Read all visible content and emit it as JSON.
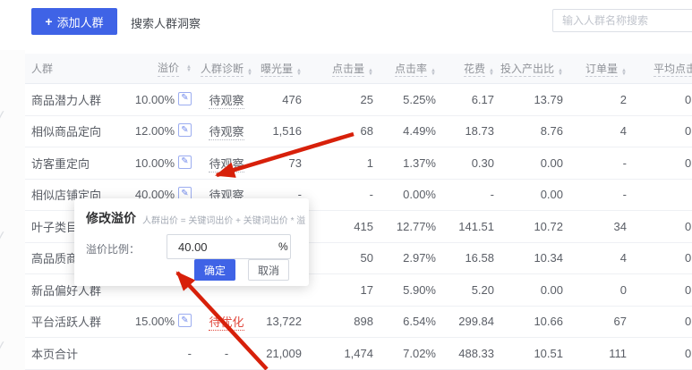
{
  "colors": {
    "accent_blue": "#3f63e6",
    "status_red": "#e0493e",
    "annotation_arrow_red": "#d7200a"
  },
  "icons": {
    "plus": "+",
    "pencil": "✎",
    "sort_up": "▲",
    "sort_down": "▼",
    "watermark_check": "✓"
  },
  "toolbar": {
    "add_button_label": "添加人群",
    "insight_link_label": "搜索人群洞察",
    "search_placeholder": "输入人群名称搜索"
  },
  "table": {
    "columns": [
      {
        "label": "人群",
        "sortable": false,
        "underline": false
      },
      {
        "label": "溢价",
        "sortable": true,
        "underline": true
      },
      {
        "label": "人群诊断",
        "sortable": true,
        "underline": true
      },
      {
        "label": "曝光量",
        "sortable": true,
        "underline": true
      },
      {
        "label": "点击量",
        "sortable": true,
        "underline": true
      },
      {
        "label": "点击率",
        "sortable": true,
        "underline": true
      },
      {
        "label": "花费",
        "sortable": true,
        "underline": true
      },
      {
        "label": "投入产出比",
        "sortable": true,
        "underline": true
      },
      {
        "label": "订单量",
        "sortable": true,
        "underline": true
      },
      {
        "label": "平均点击花费",
        "sortable": false,
        "underline": true
      }
    ],
    "rows": [
      {
        "name": "商品潜力人群",
        "premium": "10.00%",
        "has_edit": true,
        "diagnosis": "待观察",
        "status": "observe",
        "exposure": "476",
        "clicks": "25",
        "ctr": "5.25%",
        "cost": "6.17",
        "roi": "13.79",
        "orders": "2",
        "avg_cpc": "0"
      },
      {
        "name": "相似商品定向",
        "premium": "12.00%",
        "has_edit": true,
        "diagnosis": "待观察",
        "status": "observe",
        "exposure": "1,516",
        "clicks": "68",
        "ctr": "4.49%",
        "cost": "18.73",
        "roi": "8.76",
        "orders": "4",
        "avg_cpc": "0"
      },
      {
        "name": "访客重定向",
        "premium": "10.00%",
        "has_edit": true,
        "diagnosis": "待观察",
        "status": "observe",
        "exposure": "73",
        "clicks": "1",
        "ctr": "1.37%",
        "cost": "0.30",
        "roi": "0.00",
        "orders": "-",
        "avg_cpc": "0"
      },
      {
        "name": "相似店铺定向",
        "premium": "40.00%",
        "has_edit": true,
        "diagnosis": "待观察",
        "status": "observe",
        "exposure": "-",
        "clicks": "-",
        "ctr": "0.00%",
        "cost": "-",
        "roi": "0.00",
        "orders": "-",
        "avg_cpc": ""
      },
      {
        "name": "叶子类目定向",
        "premium": "",
        "has_edit": false,
        "diagnosis": "",
        "status": "",
        "exposure": "",
        "clicks": "415",
        "ctr": "12.77%",
        "cost": "141.51",
        "roi": "10.72",
        "orders": "34",
        "avg_cpc": "0"
      },
      {
        "name": "高品质商品人群",
        "premium": "",
        "has_edit": false,
        "diagnosis": "",
        "status": "",
        "exposure": "",
        "clicks": "50",
        "ctr": "2.97%",
        "cost": "16.58",
        "roi": "10.34",
        "orders": "4",
        "avg_cpc": "0"
      },
      {
        "name": "新品偏好人群",
        "premium": "",
        "has_edit": false,
        "diagnosis": "",
        "status": "",
        "exposure": "",
        "clicks": "17",
        "ctr": "5.90%",
        "cost": "5.20",
        "roi": "0.00",
        "orders": "0",
        "avg_cpc": "0"
      },
      {
        "name": "平台活跃人群",
        "premium": "15.00%",
        "has_edit": true,
        "diagnosis": "待优化",
        "status": "optimize",
        "exposure": "13,722",
        "clicks": "898",
        "ctr": "6.54%",
        "cost": "299.84",
        "roi": "10.66",
        "orders": "67",
        "avg_cpc": "0"
      },
      {
        "name": "本页合计",
        "premium": "-",
        "has_edit": false,
        "diagnosis": "-",
        "status": "",
        "exposure": "21,009",
        "clicks": "1,474",
        "ctr": "7.02%",
        "cost": "488.33",
        "roi": "10.51",
        "orders": "111",
        "avg_cpc": "0",
        "is_total": true
      }
    ]
  },
  "modal": {
    "title": "修改溢价",
    "formula": "人群出价 = 关键词出价 + 关键词出价 * 溢价",
    "field_label": "溢价比例：",
    "value": "40.00",
    "unit": "%",
    "confirm_label": "确定",
    "cancel_label": "取消"
  }
}
